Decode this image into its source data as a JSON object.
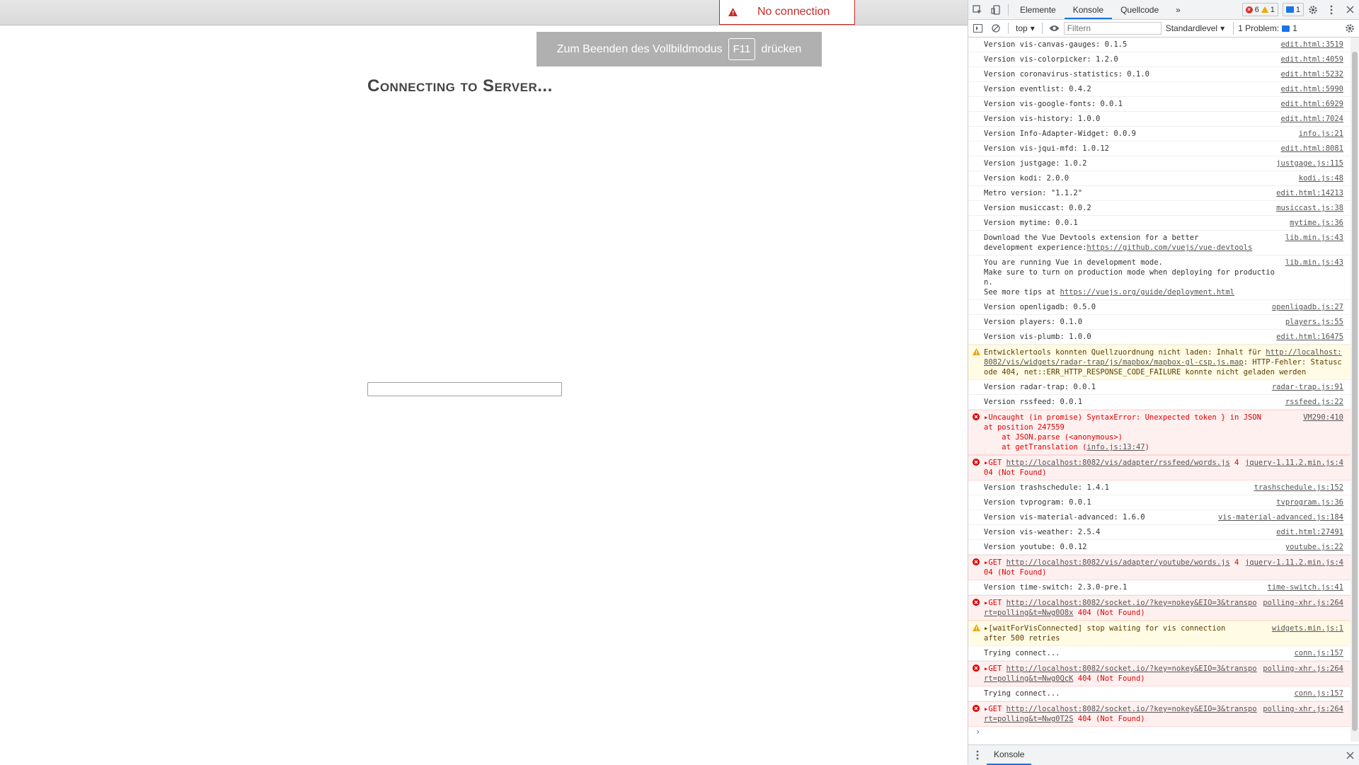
{
  "page": {
    "no_connection": "No connection",
    "fullscreen_pre": "Zum Beenden des Vollbildmodus",
    "fullscreen_key": "F11",
    "fullscreen_post": "drücken",
    "connecting": "Connecting to Server..."
  },
  "devtools": {
    "tabs": [
      "Elemente",
      "Konsole",
      "Quellcode"
    ],
    "more": "»",
    "errors_count": "6",
    "warnings_count": "1",
    "messages_count": "1",
    "toolbar": {
      "context": "top",
      "filter_placeholder": "Filtern",
      "level": "Standardlevel",
      "problems": "1 Problem:",
      "problems_count": "1"
    },
    "drawer_tab": "Konsole",
    "prompt": "›"
  },
  "console": [
    {
      "level": "info",
      "text": "Version vis-canvas-gauges: 0.1.5",
      "src": "edit.html:3519"
    },
    {
      "level": "info",
      "text": "Version vis-colorpicker: 1.2.0",
      "src": "edit.html:4059"
    },
    {
      "level": "info",
      "text": "Version coronavirus-statistics: 0.1.0",
      "src": "edit.html:5232"
    },
    {
      "level": "info",
      "text": "Version eventlist: 0.4.2",
      "src": "edit.html:5990"
    },
    {
      "level": "info",
      "text": "Version vis-google-fonts: 0.0.1",
      "src": "edit.html:6929"
    },
    {
      "level": "info",
      "text": "Version vis-history: 1.0.0",
      "src": "edit.html:7024"
    },
    {
      "level": "info",
      "text": "Version Info-Adapter-Widget: 0.0.9",
      "src": "info.js:21"
    },
    {
      "level": "info",
      "text": "Version vis-jqui-mfd: 1.0.12",
      "src": "edit.html:8081"
    },
    {
      "level": "info",
      "text": "Version justgage: 1.0.2",
      "src": "justgage.js:115"
    },
    {
      "level": "info",
      "text": "Version kodi: 2.0.0",
      "src": "kodi.js:48"
    },
    {
      "level": "info",
      "text": "Metro version: \"1.1.2\"",
      "src": "edit.html:14213"
    },
    {
      "level": "info",
      "text": "Version musiccast: 0.0.2",
      "src": "musiccast.js:38"
    },
    {
      "level": "info",
      "text": "Version mytime: 0.0.1",
      "src": "mytime.js:36"
    },
    {
      "level": "info",
      "text": "Download the Vue Devtools extension for a better\ndevelopment experience:",
      "link": "https://github.com/vuejs/vue-devtools",
      "src": "lib.min.js:43"
    },
    {
      "level": "info",
      "text": "You are running Vue in development mode.\nMake sure to turn on production mode when deploying for production.\nSee more tips at ",
      "link": "https://vuejs.org/guide/deployment.html",
      "src": "lib.min.js:43"
    },
    {
      "level": "info",
      "text": "Version openligadb: 0.5.0",
      "src": "openligadb.js:27"
    },
    {
      "level": "info",
      "text": "Version players: 0.1.0",
      "src": "players.js:55"
    },
    {
      "level": "info",
      "text": "Version vis-plumb: 1.0.0",
      "src": "edit.html:16475"
    },
    {
      "level": "warn",
      "text": "Entwicklertools konnten Quellzuordnung nicht laden: Inhalt für ",
      "link": "http://localhost:8082/vis/widgets/radar-trap/js/mapbox/mapbox-gl-csp.js.map",
      "tail": ": HTTP-Fehler: Statuscode 404, net::ERR_HTTP_RESPONSE_CODE_FAILURE konnte nicht geladen werden",
      "src": ""
    },
    {
      "level": "info",
      "text": "Version radar-trap: 0.0.1",
      "src": "radar-trap.js:91"
    },
    {
      "level": "info",
      "text": "Version rssfeed: 0.0.1",
      "src": "rssfeed.js:22"
    },
    {
      "level": "error",
      "text": "▸Uncaught (in promise) SyntaxError: Unexpected token } in JSON\nat position 247559\n    at JSON.parse (<anonymous>)\n    at getTranslation (",
      "link": "info.js:13:47",
      "tail": ")",
      "src": "VM290:410"
    },
    {
      "level": "error",
      "text": "▸GET ",
      "link": "http://localhost:8082/vis/adapter/rssfeed/words.js",
      "tail": " 404 (Not Found)",
      "src": "jquery-1.11.2.min.js:4"
    },
    {
      "level": "info",
      "text": "Version trashschedule: 1.4.1",
      "src": "trashschedule.js:152"
    },
    {
      "level": "info",
      "text": "Version tvprogram: 0.0.1",
      "src": "tvprogram.js:36"
    },
    {
      "level": "info",
      "text": "Version vis-material-advanced: 1.6.0",
      "src": "vis-material-advanced.js:184"
    },
    {
      "level": "info",
      "text": "Version vis-weather: 2.5.4",
      "src": "edit.html:27491"
    },
    {
      "level": "info",
      "text": "Version youtube: 0.0.12",
      "src": "youtube.js:22"
    },
    {
      "level": "error",
      "text": "▸GET ",
      "link": "http://localhost:8082/vis/adapter/youtube/words.js",
      "tail": " 404 (Not Found)",
      "src": "jquery-1.11.2.min.js:4"
    },
    {
      "level": "info",
      "text": "Version time-switch: 2.3.0-pre.1",
      "src": "time-switch.js:41"
    },
    {
      "level": "error",
      "text": "▸GET ",
      "link": "http://localhost:8082/socket.io/?key=nokey&EIO=3&transport=polling&t=Nwg0O8x",
      "tail": " 404 (Not Found)",
      "src": "polling-xhr.js:264"
    },
    {
      "level": "warn",
      "text": "▸[waitForVisConnected] stop waiting for vis connection\nafter 500 retries",
      "src": "widgets.min.js:1"
    },
    {
      "level": "info",
      "text": "Trying connect...",
      "src": "conn.js:157"
    },
    {
      "level": "error",
      "text": "▸GET ",
      "link": "http://localhost:8082/socket.io/?key=nokey&EIO=3&transport=polling&t=Nwg0QcK",
      "tail": " 404 (Not Found)",
      "src": "polling-xhr.js:264"
    },
    {
      "level": "info",
      "text": "Trying connect...",
      "src": "conn.js:157"
    },
    {
      "level": "error",
      "text": "▸GET ",
      "link": "http://localhost:8082/socket.io/?key=nokey&EIO=3&transport=polling&t=Nwg0T2S",
      "tail": " 404 (Not Found)",
      "src": "polling-xhr.js:264"
    }
  ]
}
